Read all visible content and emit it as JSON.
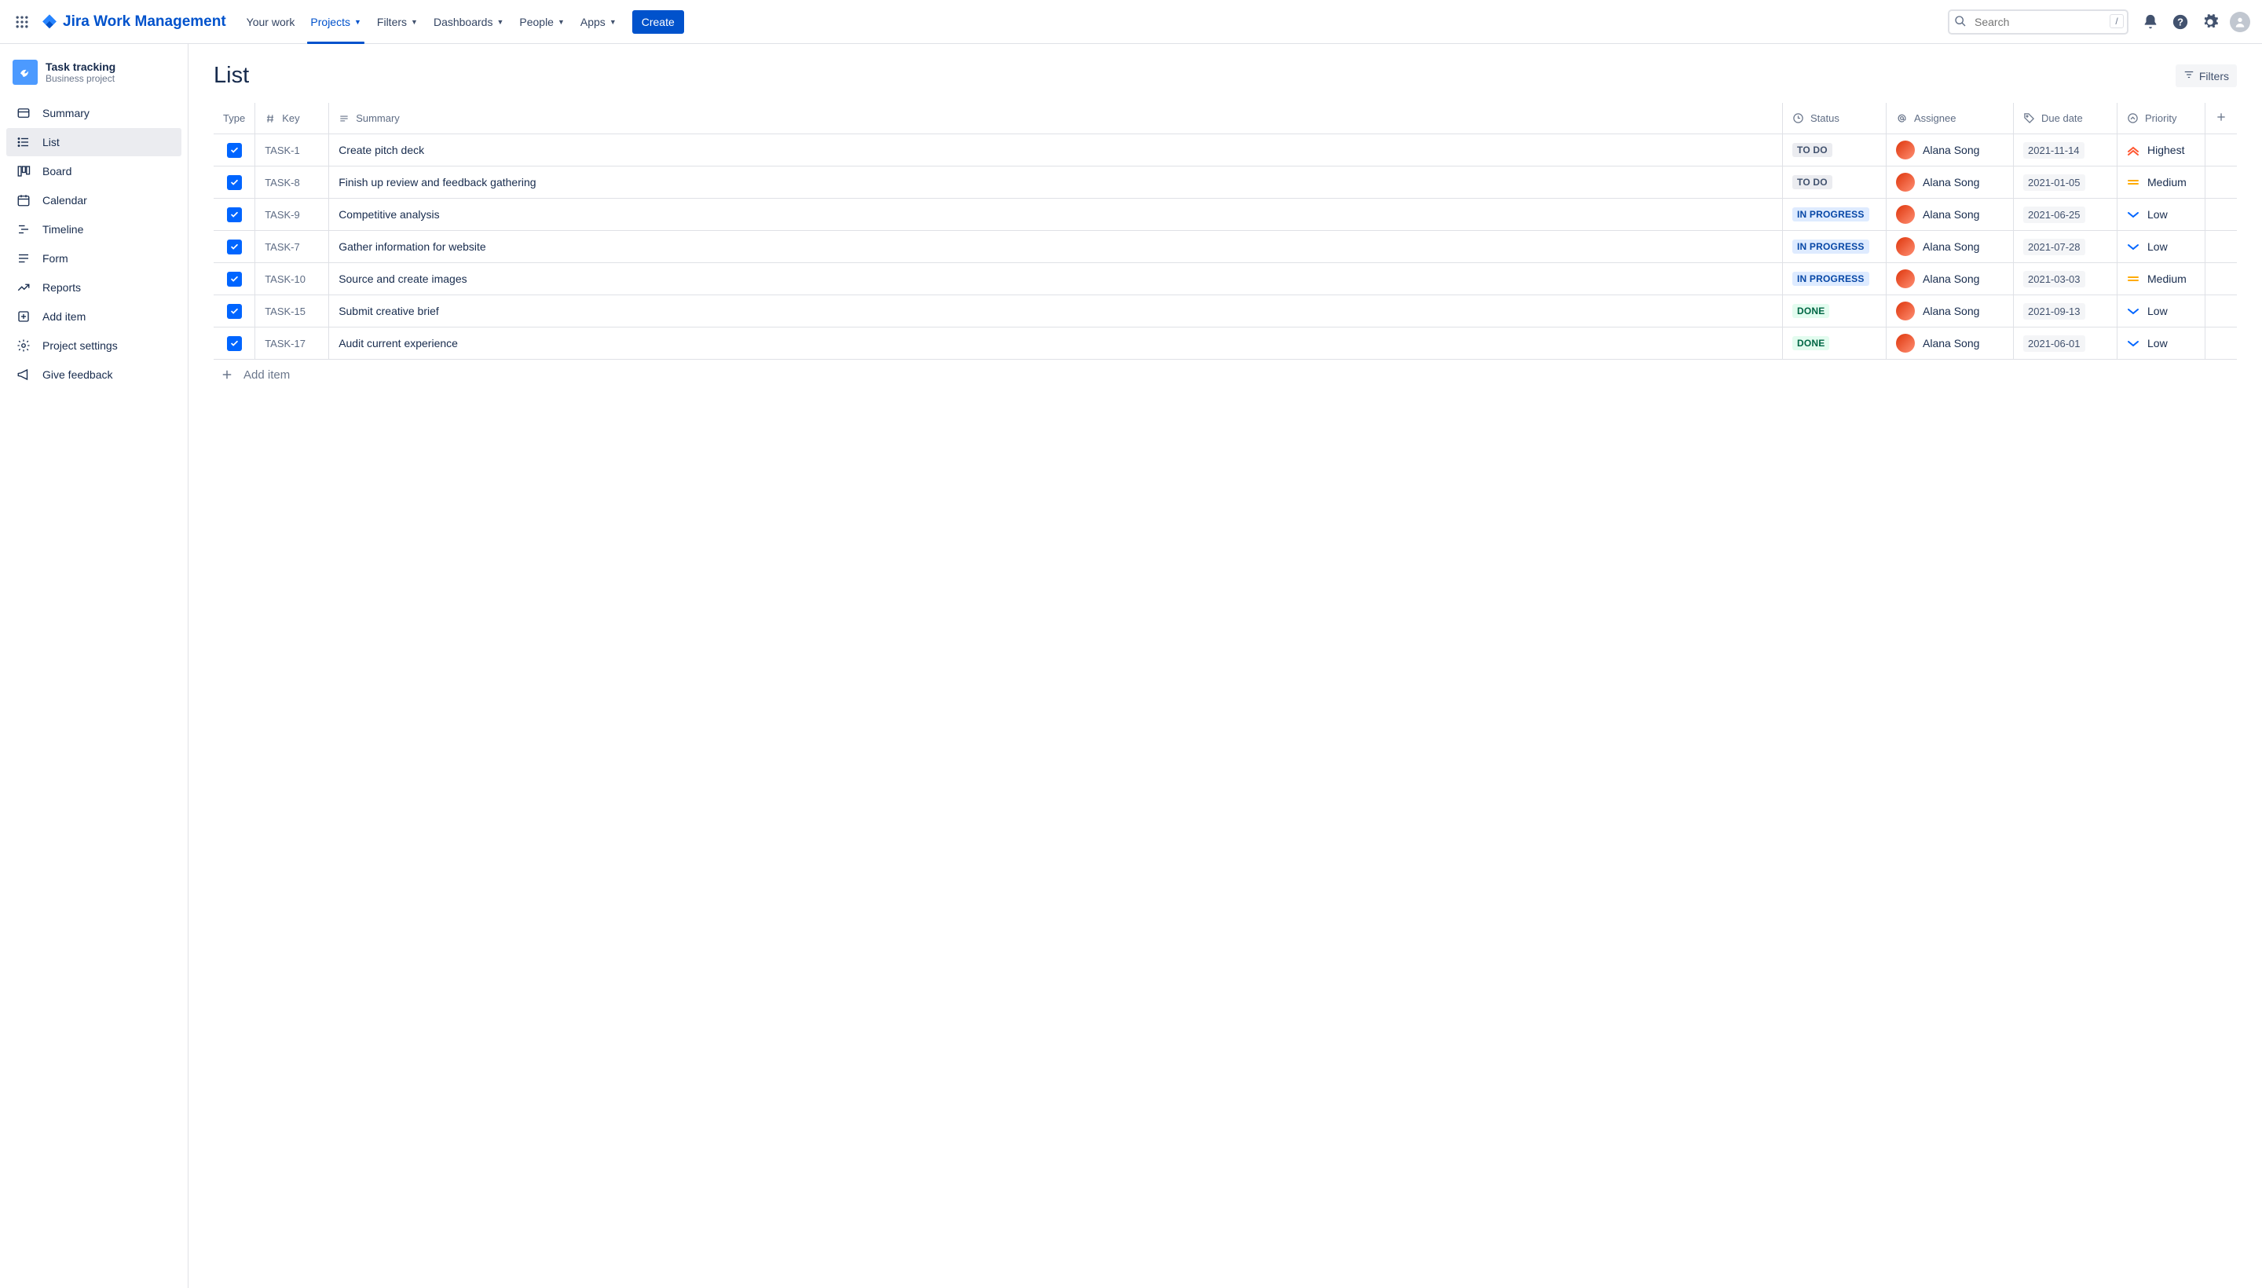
{
  "brand": "Jira Work Management",
  "nav": {
    "your_work": "Your work",
    "projects": "Projects",
    "filters": "Filters",
    "dashboards": "Dashboards",
    "people": "People",
    "apps": "Apps",
    "create": "Create"
  },
  "search": {
    "placeholder": "Search",
    "shortcut": "/"
  },
  "project": {
    "name": "Task tracking",
    "subtitle": "Business project"
  },
  "sidebar": {
    "summary": "Summary",
    "list": "List",
    "board": "Board",
    "calendar": "Calendar",
    "timeline": "Timeline",
    "form": "Form",
    "reports": "Reports",
    "add_item": "Add item",
    "project_settings": "Project settings",
    "give_feedback": "Give feedback"
  },
  "page": {
    "title": "List",
    "filters_btn": "Filters",
    "add_item": "Add item"
  },
  "columns": {
    "type": "Type",
    "key": "Key",
    "summary": "Summary",
    "status": "Status",
    "assignee": "Assignee",
    "due": "Due date",
    "priority": "Priority"
  },
  "rows": [
    {
      "key": "TASK-1",
      "summary": "Create pitch deck",
      "status": "TO DO",
      "status_class": "todo",
      "assignee": "Alana Song",
      "due": "2021-11-14",
      "priority": "Highest",
      "prio_kind": "highest"
    },
    {
      "key": "TASK-8",
      "summary": "Finish up review and feedback gathering",
      "status": "TO DO",
      "status_class": "todo",
      "assignee": "Alana Song",
      "due": "2021-01-05",
      "priority": "Medium",
      "prio_kind": "medium"
    },
    {
      "key": "TASK-9",
      "summary": "Competitive analysis",
      "status": "IN PROGRESS",
      "status_class": "inprogress",
      "assignee": "Alana Song",
      "due": "2021-06-25",
      "priority": "Low",
      "prio_kind": "low"
    },
    {
      "key": "TASK-7",
      "summary": "Gather information for website",
      "status": "IN PROGRESS",
      "status_class": "inprogress",
      "assignee": "Alana Song",
      "due": "2021-07-28",
      "priority": "Low",
      "prio_kind": "low"
    },
    {
      "key": "TASK-10",
      "summary": "Source and create images",
      "status": "IN PROGRESS",
      "status_class": "inprogress",
      "assignee": "Alana Song",
      "due": "2021-03-03",
      "priority": "Medium",
      "prio_kind": "medium"
    },
    {
      "key": "TASK-15",
      "summary": "Submit creative brief",
      "status": "DONE",
      "status_class": "done",
      "assignee": "Alana Song",
      "due": "2021-09-13",
      "priority": "Low",
      "prio_kind": "low"
    },
    {
      "key": "TASK-17",
      "summary": "Audit current experience",
      "status": "DONE",
      "status_class": "done",
      "assignee": "Alana Song",
      "due": "2021-06-01",
      "priority": "Low",
      "prio_kind": "low"
    }
  ]
}
